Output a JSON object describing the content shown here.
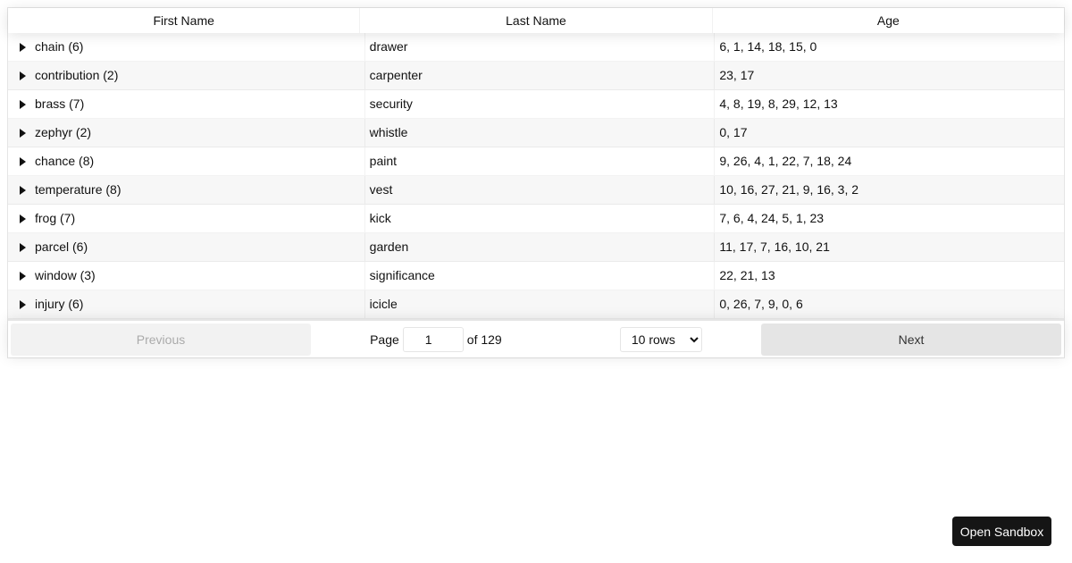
{
  "table": {
    "headers": [
      "First Name",
      "Last Name",
      "Age"
    ],
    "rows": [
      {
        "first": "chain (6)",
        "last": "drawer",
        "age": "6, 1, 14, 18, 15, 0"
      },
      {
        "first": "contribution (2)",
        "last": "carpenter",
        "age": "23, 17"
      },
      {
        "first": "brass (7)",
        "last": "security",
        "age": "4, 8, 19, 8, 29, 12, 13"
      },
      {
        "first": "zephyr (2)",
        "last": "whistle",
        "age": "0, 17"
      },
      {
        "first": "chance (8)",
        "last": "paint",
        "age": "9, 26, 4, 1, 22, 7, 18, 24"
      },
      {
        "first": "temperature (8)",
        "last": "vest",
        "age": "10, 16, 27, 21, 9, 16, 3, 2"
      },
      {
        "first": "frog (7)",
        "last": "kick",
        "age": "7, 6, 4, 24, 5, 1, 23"
      },
      {
        "first": "parcel (6)",
        "last": "garden",
        "age": "11, 17, 7, 16, 10, 21"
      },
      {
        "first": "window (3)",
        "last": "significance",
        "age": "22, 21, 13"
      },
      {
        "first": "injury (6)",
        "last": "icicle",
        "age": "0, 26, 7, 9, 0, 6"
      }
    ]
  },
  "pagination": {
    "previous_label": "Previous",
    "next_label": "Next",
    "page_label": "Page",
    "current_page": "1",
    "of_label": "of 129",
    "rows_selected": "10 rows"
  },
  "sandbox_label": "Open Sandbox",
  "icons": {
    "expander": "caret-right-icon"
  }
}
